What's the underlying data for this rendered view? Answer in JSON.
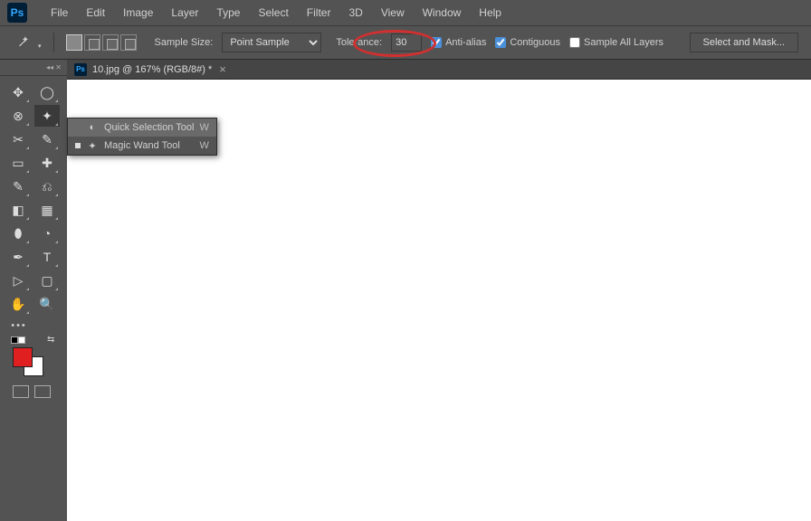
{
  "menu": [
    "File",
    "Edit",
    "Image",
    "Layer",
    "Type",
    "Select",
    "Filter",
    "3D",
    "View",
    "Window",
    "Help"
  ],
  "optbar": {
    "sample_size_label": "Sample Size:",
    "sample_size_value": "Point Sample",
    "tolerance_label": "Tolerance:",
    "tolerance_value": "30",
    "antialias": "Anti-alias",
    "contiguous": "Contiguous",
    "sample_all": "Sample All Layers",
    "select_mask": "Select and Mask..."
  },
  "doc": {
    "title": "10.jpg @ 167% (RGB/8#) *"
  },
  "flyout": {
    "items": [
      {
        "label": "Quick Selection Tool",
        "key": "W",
        "active": false
      },
      {
        "label": "Magic Wand Tool",
        "key": "W",
        "active": true
      }
    ]
  }
}
